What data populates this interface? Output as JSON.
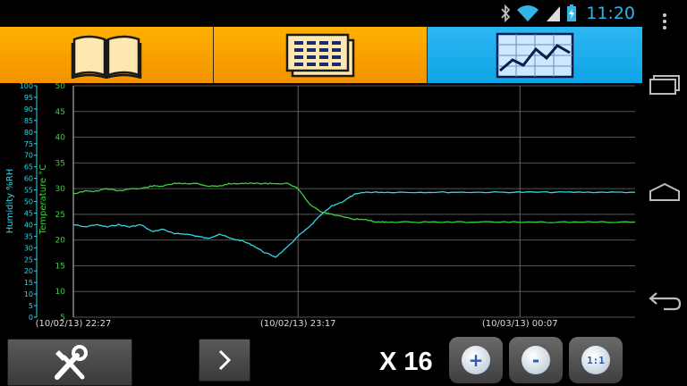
{
  "status_bar": {
    "clock": "11:20",
    "icons": [
      "bluetooth-icon",
      "wifi-icon",
      "signal-icon",
      "battery-icon"
    ]
  },
  "tabs": [
    {
      "name": "manual",
      "icon": "book-icon",
      "active": false
    },
    {
      "name": "list",
      "icon": "list-icon",
      "active": false
    },
    {
      "name": "graph",
      "icon": "graph-icon",
      "active": true
    }
  ],
  "colors": {
    "humidity": "#33d6e6",
    "temperature": "#3fcf3f",
    "tab_orange": "#f5a000",
    "tab_blue": "#1aa9ee",
    "clock": "#33b5e5"
  },
  "chart_data": {
    "type": "line",
    "y_left_label": "Humidity %RH",
    "y_left_range": [
      0,
      100
    ],
    "y_left_ticks": [
      "0",
      "5",
      "10",
      "15",
      "20",
      "25",
      "30",
      "35",
      "40",
      "45",
      "50",
      "55",
      "60",
      "65",
      "70",
      "75",
      "80",
      "85",
      "90",
      "95",
      "100"
    ],
    "y_right_label": "Temperature °C",
    "y_right_range": [
      5,
      50
    ],
    "y_right_ticks": [
      "5",
      "10",
      "15",
      "20",
      "25",
      "30",
      "35",
      "40",
      "45",
      "50"
    ],
    "x_labels": [
      "(10/02/13) 22:27",
      "(10/02/13) 23:17",
      "(10/03/13) 00:07"
    ],
    "grid": true,
    "series": [
      {
        "name": "Humidity %RH",
        "axis": "left",
        "x": [
          0,
          0.02,
          0.04,
          0.06,
          0.08,
          0.1,
          0.12,
          0.14,
          0.16,
          0.18,
          0.2,
          0.22,
          0.24,
          0.26,
          0.28,
          0.3,
          0.32,
          0.34,
          0.36,
          0.38,
          0.4,
          0.42,
          0.44,
          0.46,
          0.48,
          0.5,
          0.52,
          0.54,
          0.56,
          0.6,
          0.65,
          0.7,
          0.75,
          0.8,
          0.85,
          0.9,
          0.95,
          1.0
        ],
        "values": [
          40,
          39,
          40,
          39,
          40,
          39,
          40,
          37,
          38,
          36,
          36,
          35,
          34,
          36,
          34,
          33,
          31,
          28,
          26,
          30,
          35,
          39,
          44,
          48,
          50,
          53,
          54,
          54,
          54,
          54,
          54,
          54,
          54,
          54,
          54,
          54,
          54,
          54
        ]
      },
      {
        "name": "Temperature °C",
        "axis": "right",
        "x": [
          0,
          0.02,
          0.04,
          0.06,
          0.08,
          0.1,
          0.12,
          0.14,
          0.16,
          0.18,
          0.2,
          0.22,
          0.24,
          0.26,
          0.28,
          0.3,
          0.32,
          0.34,
          0.36,
          0.38,
          0.4,
          0.42,
          0.44,
          0.46,
          0.48,
          0.5,
          0.52,
          0.54,
          0.56,
          0.6,
          0.65,
          0.7,
          0.75,
          0.8,
          0.85,
          0.9,
          0.95,
          1.0
        ],
        "values": [
          29,
          29.5,
          29.5,
          30,
          29.5,
          30,
          30,
          30.5,
          30.5,
          31,
          31,
          31,
          30.5,
          30.5,
          31,
          31,
          31,
          31,
          31,
          31,
          30,
          27,
          25.5,
          25,
          24.5,
          24,
          24,
          23.5,
          23.5,
          23.5,
          23.5,
          23.5,
          23.5,
          23.5,
          23.5,
          23.5,
          23.5,
          23.5
        ]
      }
    ]
  },
  "toolbar": {
    "zoom_label": "X 16",
    "zoom_in_symbol": "+",
    "zoom_out_symbol": "-",
    "reset_symbol": "1:1"
  },
  "nav": [
    "recent-apps-icon",
    "home-icon",
    "back-icon",
    "overflow-menu-icon"
  ]
}
